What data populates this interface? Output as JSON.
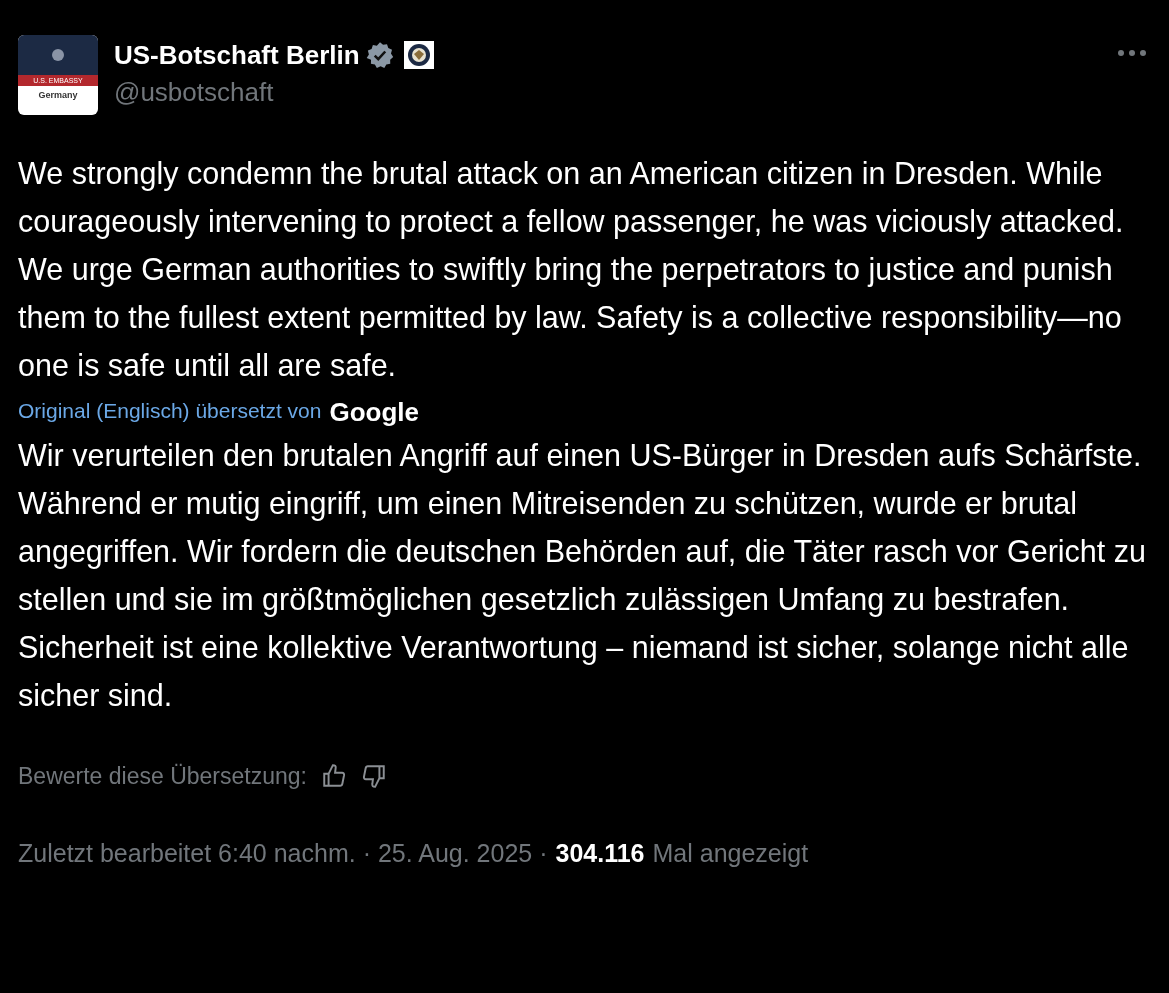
{
  "author": {
    "name": "US-Botschaft Berlin",
    "handle": "@usbotschaft",
    "verified": true,
    "avatar": {
      "band": "U.S. EMBASSY",
      "caption": "Germany"
    }
  },
  "post": {
    "text": "We strongly condemn the brutal attack on an American citizen in Dresden. While courageously intervening to protect a fellow passenger, he was viciously attacked. We urge German authorities to swiftly bring the perpetrators to justice and punish them to the fullest extent permitted by law. Safety is a collective responsibility—no one is safe until all are safe.",
    "translation_note": "Original (Englisch) übersetzt von",
    "translator": "Google",
    "translated_text": "Wir verurteilen den brutalen Angriff auf einen US-Bürger in Dresden aufs Schärfste. Während er mutig eingriff, um einen Mitreisenden zu schützen, wurde er brutal angegriffen. Wir fordern die deutschen Behörden auf, die Täter rasch vor Gericht zu stellen und sie im größtmöglichen gesetzlich zulässigen Umfang zu bestrafen. Sicherheit ist eine kollektive Verantwortung – niemand ist sicher, solange nicht alle sicher sind.",
    "rate_label": "Bewerte diese Übersetzung:"
  },
  "meta": {
    "edited": "Zuletzt bearbeitet 6:40 nachm. · 25. Aug. 2025 ·",
    "views": "304.116",
    "views_label": "Mal angezeigt"
  }
}
